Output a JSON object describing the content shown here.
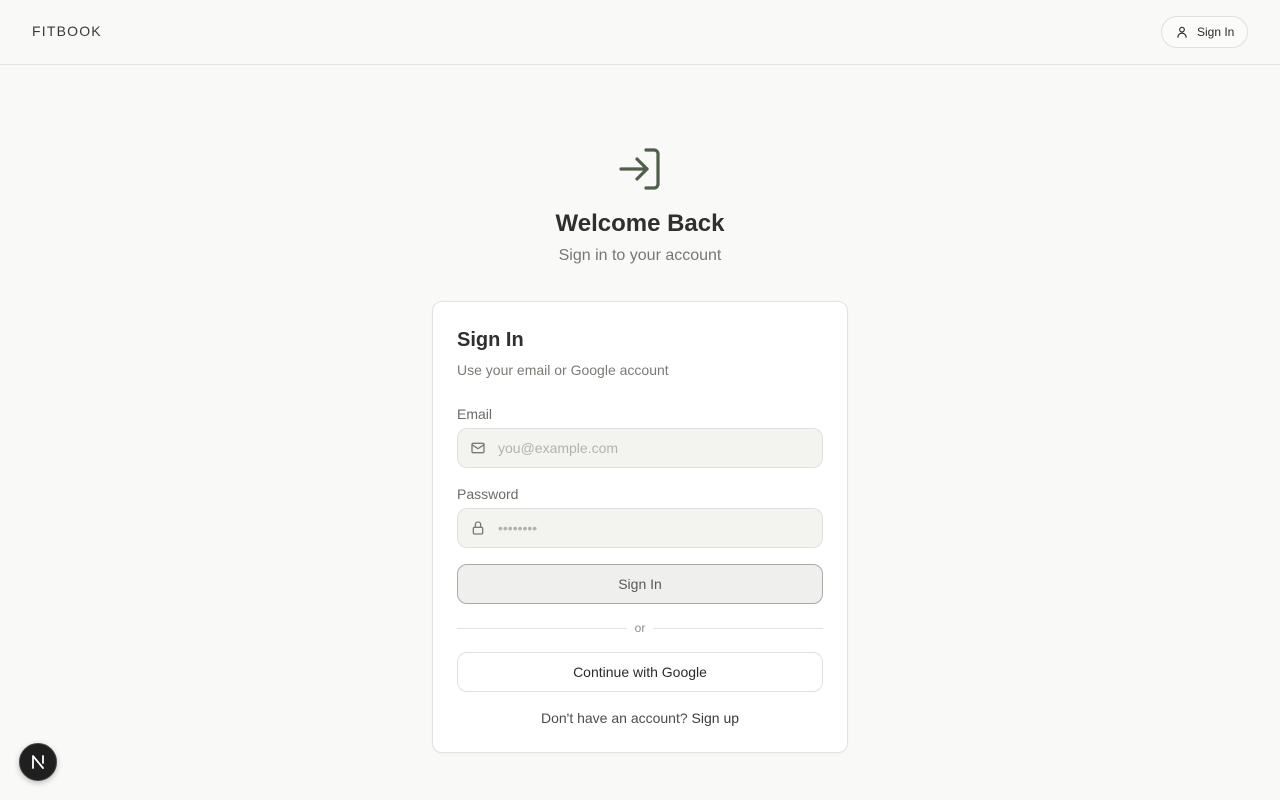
{
  "header": {
    "brand": "FITBOOK",
    "signin_label": "Sign In"
  },
  "hero": {
    "icon": "log-in-icon",
    "title": "Welcome Back",
    "subtitle": "Sign in to your account"
  },
  "card": {
    "title": "Sign In",
    "subtitle": "Use your email or Google account",
    "email": {
      "label": "Email",
      "placeholder": "you@example.com",
      "value": "",
      "icon": "mail-icon"
    },
    "password": {
      "label": "Password",
      "placeholder": "••••••••",
      "value": "",
      "icon": "lock-icon"
    },
    "submit_label": "Sign In",
    "divider_text": "or",
    "google_label": "Continue with Google",
    "signup_prompt": "Don't have an account?",
    "signup_link": "Sign up"
  },
  "colors": {
    "accent": "#4f5f4a",
    "background": "#f9f9f7"
  }
}
